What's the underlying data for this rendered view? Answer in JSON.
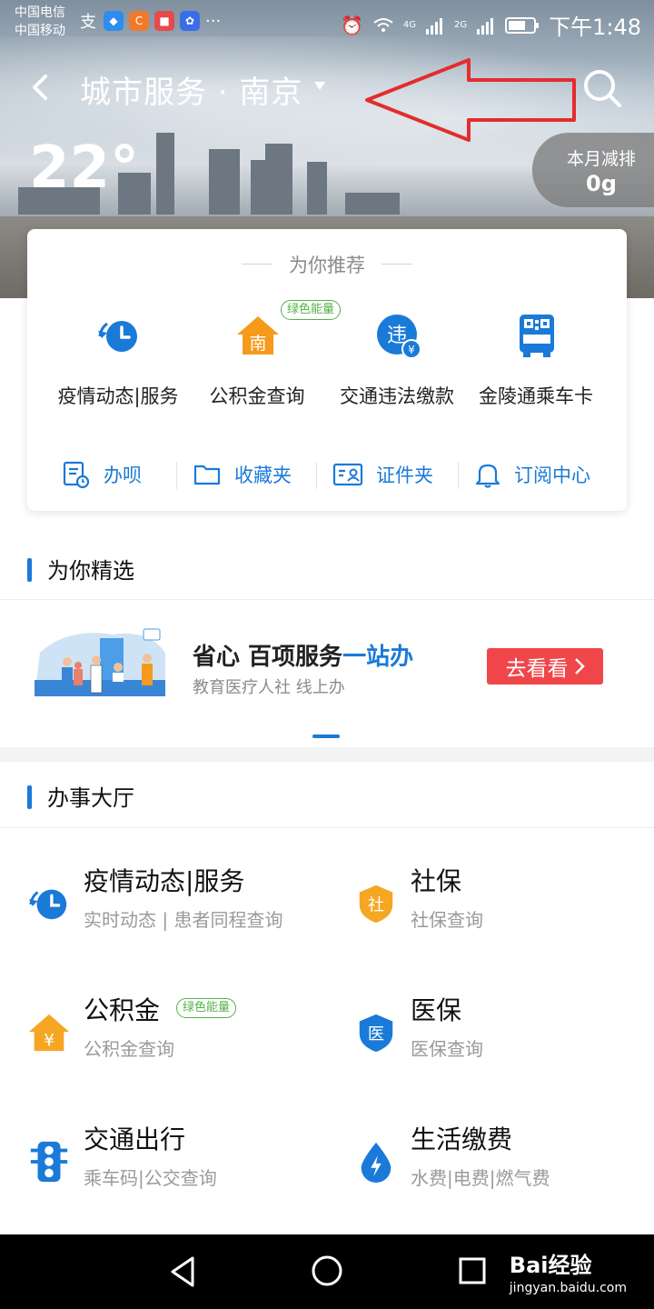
{
  "status_bar": {
    "carrier_1": "中国电信",
    "carrier_2": "中国移动",
    "signal_1": "4G",
    "signal_2": "2G",
    "time": "下午1:48"
  },
  "header": {
    "title": "城市服务 · 南京",
    "temperature": "22°",
    "emission_label": "本月减排",
    "emission_value": "0g"
  },
  "recommend": {
    "title": "为你推荐",
    "items": [
      {
        "label": "疫情动态|服务",
        "icon": "clock-refresh-icon"
      },
      {
        "label": "公积金查询",
        "icon": "house-nan-icon",
        "badge": "绿色能量"
      },
      {
        "label": "交通违法缴款",
        "icon": "violation-yuan-icon"
      },
      {
        "label": "金陵通乘车卡",
        "icon": "bus-qrcode-icon"
      }
    ],
    "tools": [
      {
        "label": "办呗",
        "icon": "document-clock-icon"
      },
      {
        "label": "收藏夹",
        "icon": "folder-icon"
      },
      {
        "label": "证件夹",
        "icon": "id-card-icon"
      },
      {
        "label": "订阅中心",
        "icon": "bell-icon"
      }
    ]
  },
  "featured": {
    "section_title": "为你精选",
    "banner_title_1": "省心 百项服务",
    "banner_title_2": "一站办",
    "banner_sub": "教育医疗人社 线上办",
    "cta": "去看看"
  },
  "hall": {
    "section_title": "办事大厅",
    "services": [
      {
        "name": "疫情动态|服务",
        "sub": "实时动态 | 患者同程查询",
        "icon": "clock-refresh-icon"
      },
      {
        "name": "社保",
        "sub": "社保查询",
        "icon": "shield-she-icon"
      },
      {
        "name": "公积金",
        "sub": "公积金查询",
        "icon": "house-yuan-icon",
        "badge": "绿色能量"
      },
      {
        "name": "医保",
        "sub": "医保查询",
        "icon": "shield-yi-icon"
      },
      {
        "name": "交通出行",
        "sub": "乘车码|公交查询",
        "icon": "traffic-light-icon"
      },
      {
        "name": "生活缴费",
        "sub": "水费|电费|燃气费",
        "icon": "drop-lightning-icon"
      }
    ]
  },
  "icon_glyphs": {
    "nan": "南",
    "wei": "违",
    "yuan": "¥",
    "she": "社",
    "yi": "医"
  },
  "watermark": {
    "brand": "Bai经验",
    "url": "jingyan.baidu.com"
  },
  "colors": {
    "accent_blue": "#1a7ad8",
    "orange": "#f59a1b",
    "green": "#56b04a",
    "cta_red": "#f0464a"
  }
}
